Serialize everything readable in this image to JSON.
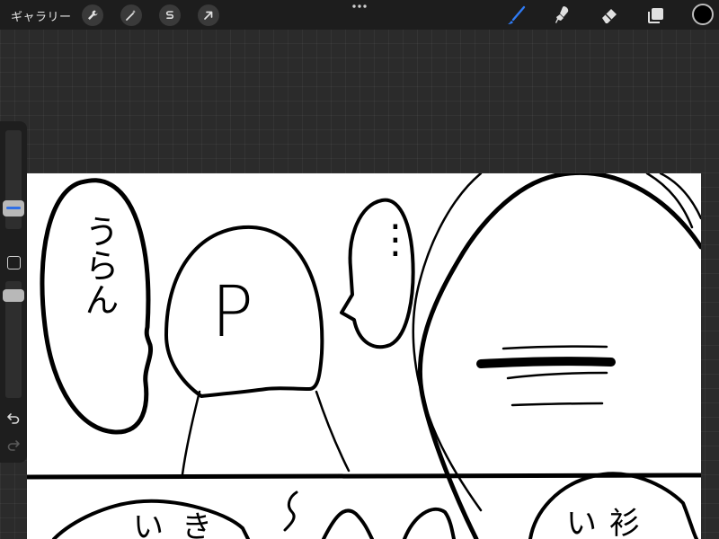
{
  "app": {
    "gallery_label": "ギャラリー"
  },
  "toolbar": {
    "left_tools": [
      {
        "name": "actions",
        "icon": "wrench-icon"
      },
      {
        "name": "adjustments",
        "icon": "magic-wand-icon"
      },
      {
        "name": "selection",
        "icon": "selection-s-icon"
      },
      {
        "name": "transform",
        "icon": "arrow-cursor-icon"
      }
    ],
    "more_icon": "ellipsis-icon",
    "right_tools": [
      {
        "name": "brush",
        "icon": "brush-icon",
        "active": true,
        "color": "#2f7bf5"
      },
      {
        "name": "smudge",
        "icon": "smudge-icon",
        "active": false
      },
      {
        "name": "eraser",
        "icon": "eraser-icon",
        "active": false
      },
      {
        "name": "layers",
        "icon": "layers-icon",
        "active": false
      }
    ],
    "current_color": "#000000"
  },
  "sidebar": {
    "brush_size_icon": "size-slider-icon",
    "modify_icon": "square-icon",
    "opacity_icon": "opacity-slider-icon",
    "undo_icon": "undo-icon",
    "redo_icon": "redo-icon"
  },
  "canvas": {
    "background": "#ffffff",
    "ink": "#000000",
    "handwritten_text": {
      "bubble_left": "うらん",
      "head_letter": "P",
      "bubble_dots": "⋮",
      "bottom_panel_left": "いき",
      "bottom_panel_right": "い衫"
    }
  },
  "colors": {
    "topbar": "#1d1d1d",
    "workspace": "#2b2b2b",
    "accent": "#2f7bf5"
  }
}
